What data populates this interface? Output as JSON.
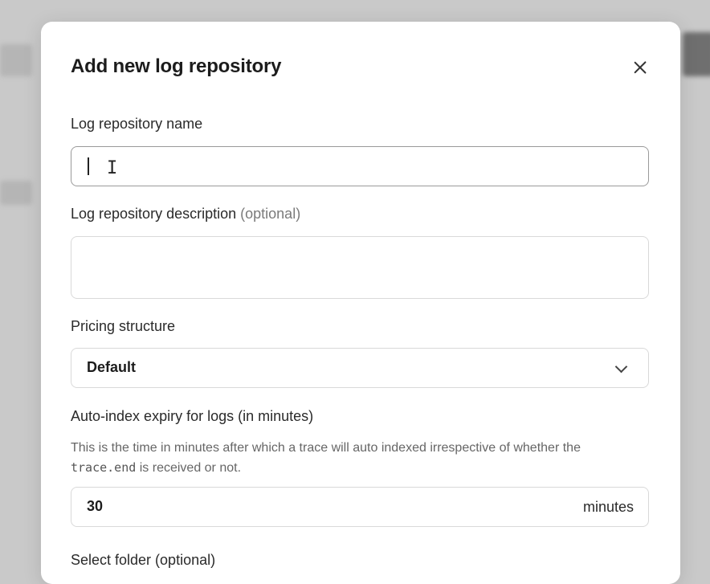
{
  "dialog": {
    "title": "Add new log repository",
    "close_icon": "close-icon"
  },
  "fields": {
    "name": {
      "label": "Log repository name",
      "value": ""
    },
    "description": {
      "label": "Log repository description",
      "optional": "(optional)",
      "value": ""
    },
    "pricing": {
      "label": "Pricing structure",
      "selected": "Default"
    },
    "expiry": {
      "label": "Auto-index expiry for logs (in minutes)",
      "help_before": "This is the time in minutes after which a trace will auto indexed irrespective of whether the",
      "help_code": "trace.end",
      "help_after": "is received or not.",
      "value": "30",
      "unit": "minutes"
    },
    "folder": {
      "label": "Select folder (optional)"
    }
  }
}
